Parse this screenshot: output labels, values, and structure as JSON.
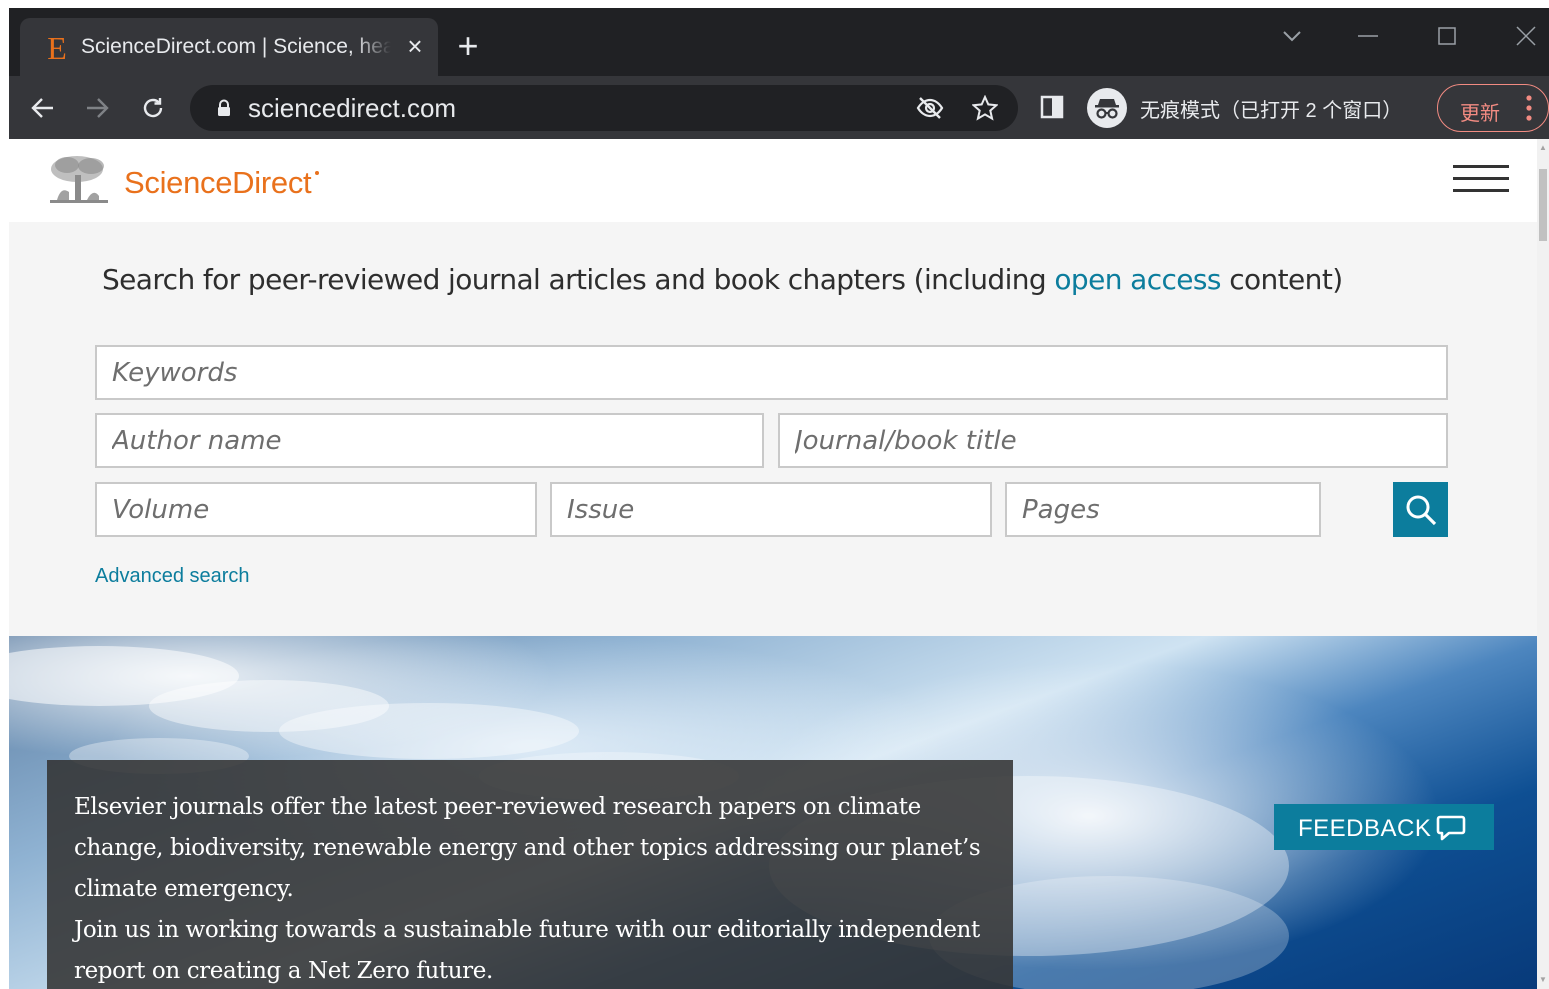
{
  "browser": {
    "tab": {
      "title": "ScienceDirect.com | Science, health and medical journals, full text articles and books.",
      "favicon_letter": "E"
    },
    "toolbar": {
      "url": "sciencedirect.com",
      "incognito_label": "无痕模式（已打开 2 个窗口）",
      "update_label": "更新"
    },
    "colors": {
      "tabstrip": "#202124",
      "toolbar": "#35363a",
      "update_accent": "#f28b82"
    }
  },
  "site": {
    "logo_text": "ScienceDirect",
    "colors": {
      "brand_orange": "#e9711c",
      "accent_blue": "#0c7d9d"
    }
  },
  "search": {
    "heading_prefix": "Search for peer-reviewed journal articles and book chapters (including ",
    "heading_link": "open access",
    "heading_suffix": " content)",
    "keywords_placeholder": "Keywords",
    "author_placeholder": "Author name",
    "journal_placeholder": "Journal/book title",
    "volume_placeholder": "Volume",
    "issue_placeholder": "Issue",
    "pages_placeholder": "Pages",
    "advanced_link": "Advanced search"
  },
  "banner": {
    "line1": "Elsevier journals offer the latest peer-reviewed research papers on climate change, biodiversity, renewable energy and other topics addressing our planet’s climate emergency.",
    "line2": "Join us in working towards a sustainable future with our editorially independent report on creating a Net Zero future."
  },
  "feedback": {
    "label": "FEEDBACK"
  }
}
